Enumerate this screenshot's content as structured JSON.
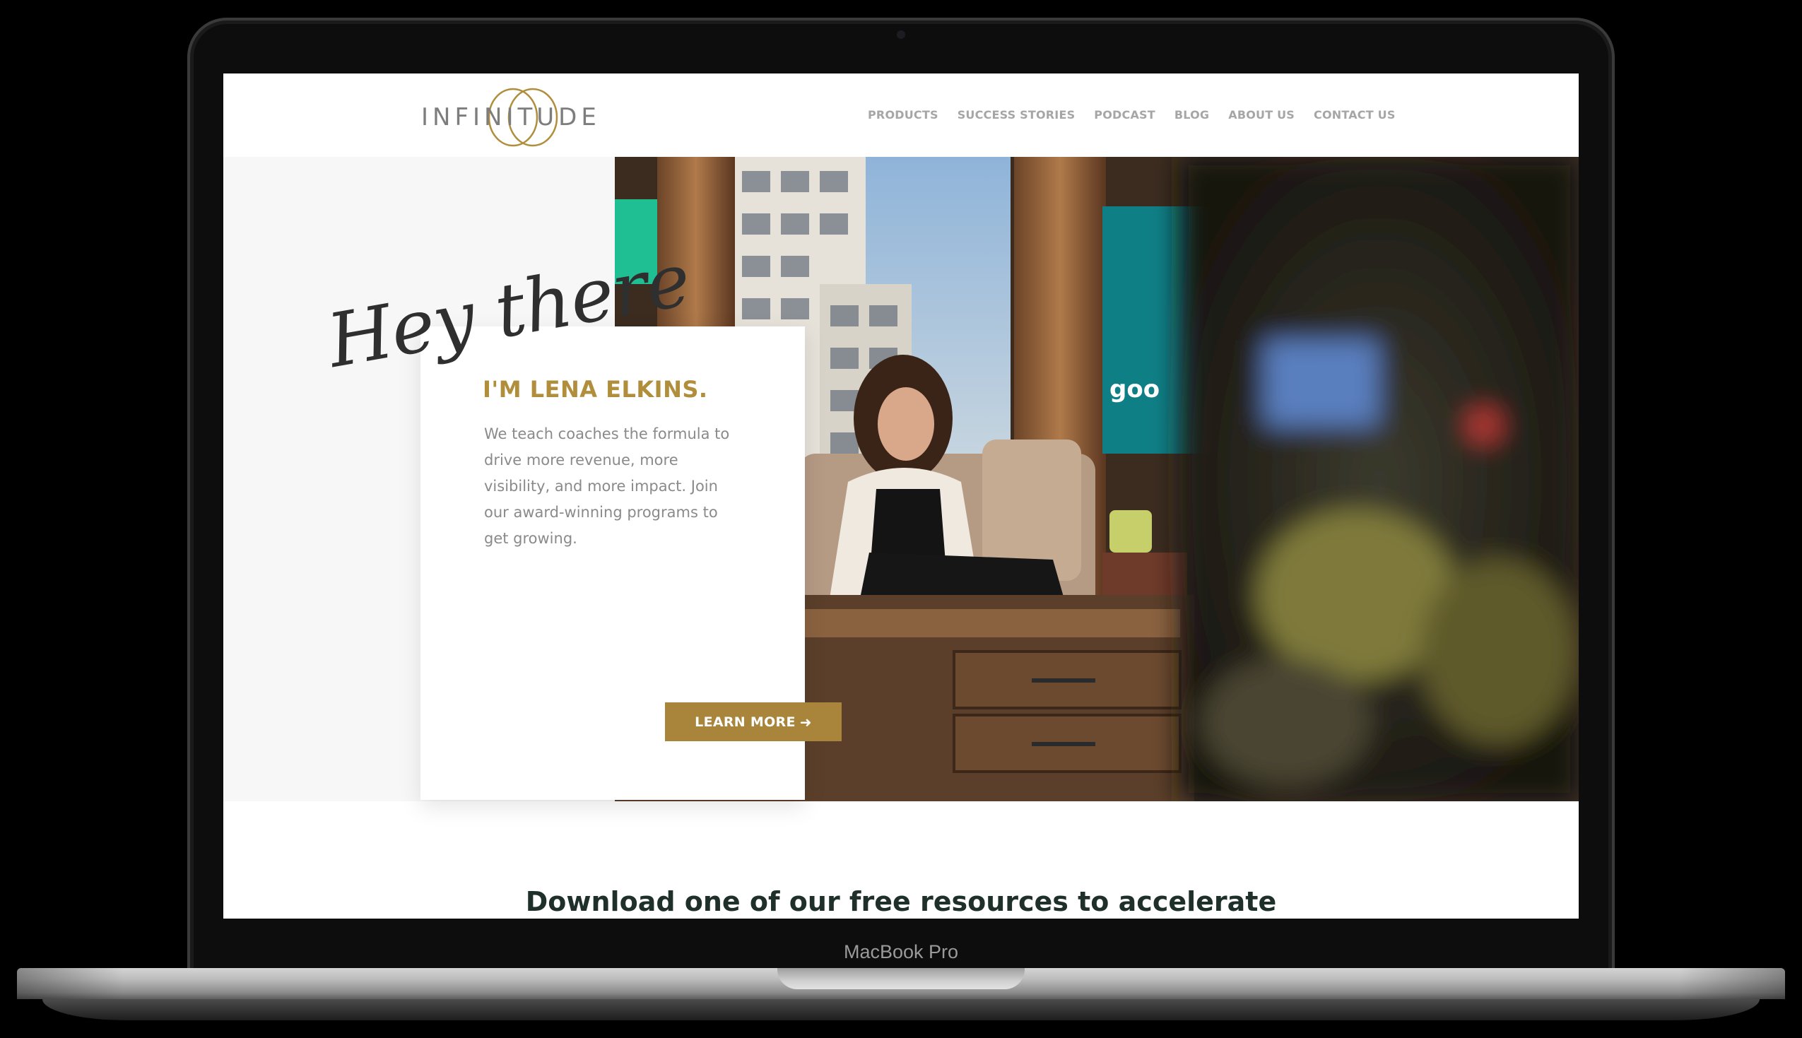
{
  "device": {
    "label": "MacBook Pro"
  },
  "site": {
    "logo_text": "INFINITUDE",
    "nav": [
      {
        "label": "PRODUCTS"
      },
      {
        "label": "SUCCESS STORIES"
      },
      {
        "label": "PODCAST"
      },
      {
        "label": "BLOG"
      },
      {
        "label": "ABOUT US"
      },
      {
        "label": "CONTACT US"
      }
    ]
  },
  "hero": {
    "greeting": "Hey there",
    "heading": "I'M LENA ELKINS.",
    "body": "We teach coaches the formula to drive more revenue, more visibility, and more impact. Join our award-winning programs to get growing.",
    "cta_label": "LEARN MORE",
    "cta_icon": "arrow-right-icon",
    "photo_description_icon": "hero-photo"
  },
  "resources": {
    "heading": "Download one of our free resources to accelerate"
  },
  "colors": {
    "accent_gold": "#a8853a",
    "heading_gold": "#b08e3c",
    "nav_gray": "#a6a6a6",
    "body_gray": "#8a8a8a",
    "dark_green": "#1f2f2a"
  }
}
